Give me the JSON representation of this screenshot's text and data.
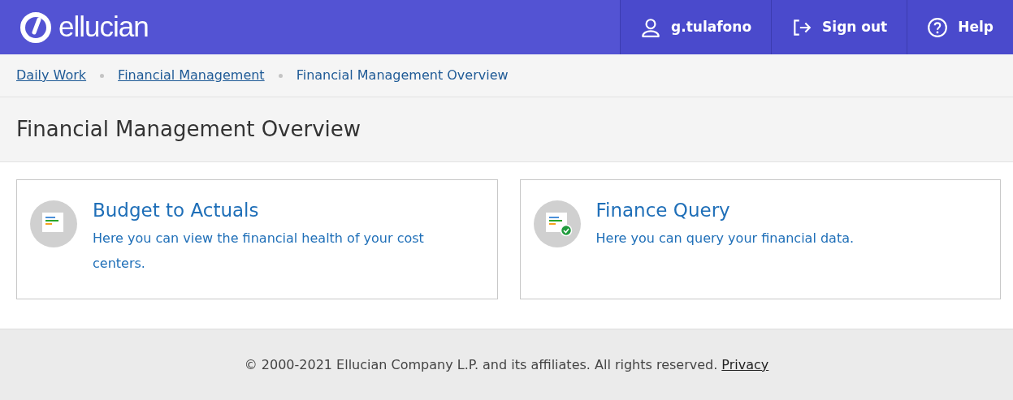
{
  "header": {
    "logo": "ellucian",
    "items": [
      {
        "kind": "user",
        "label": "g.tulafono"
      },
      {
        "kind": "signout",
        "label": "Sign out"
      },
      {
        "kind": "help",
        "label": "Help"
      }
    ]
  },
  "breadcrumbs": [
    {
      "label": "Daily Work",
      "link": true
    },
    {
      "label": "Financial Management",
      "link": true
    },
    {
      "label": "Financial Management Overview",
      "link": false
    }
  ],
  "page_title": "Financial Management Overview",
  "cards": [
    {
      "kind": "report",
      "title": "Budget to Actuals",
      "description": "Here you can view the financial health of your cost centers."
    },
    {
      "kind": "query",
      "title": "Finance Query",
      "description": "Here you can query your financial data."
    }
  ],
  "footer": {
    "text": "© 2000-2021 Ellucian Company L.P. and its affiliates. All rights reserved.",
    "link": "Privacy"
  }
}
